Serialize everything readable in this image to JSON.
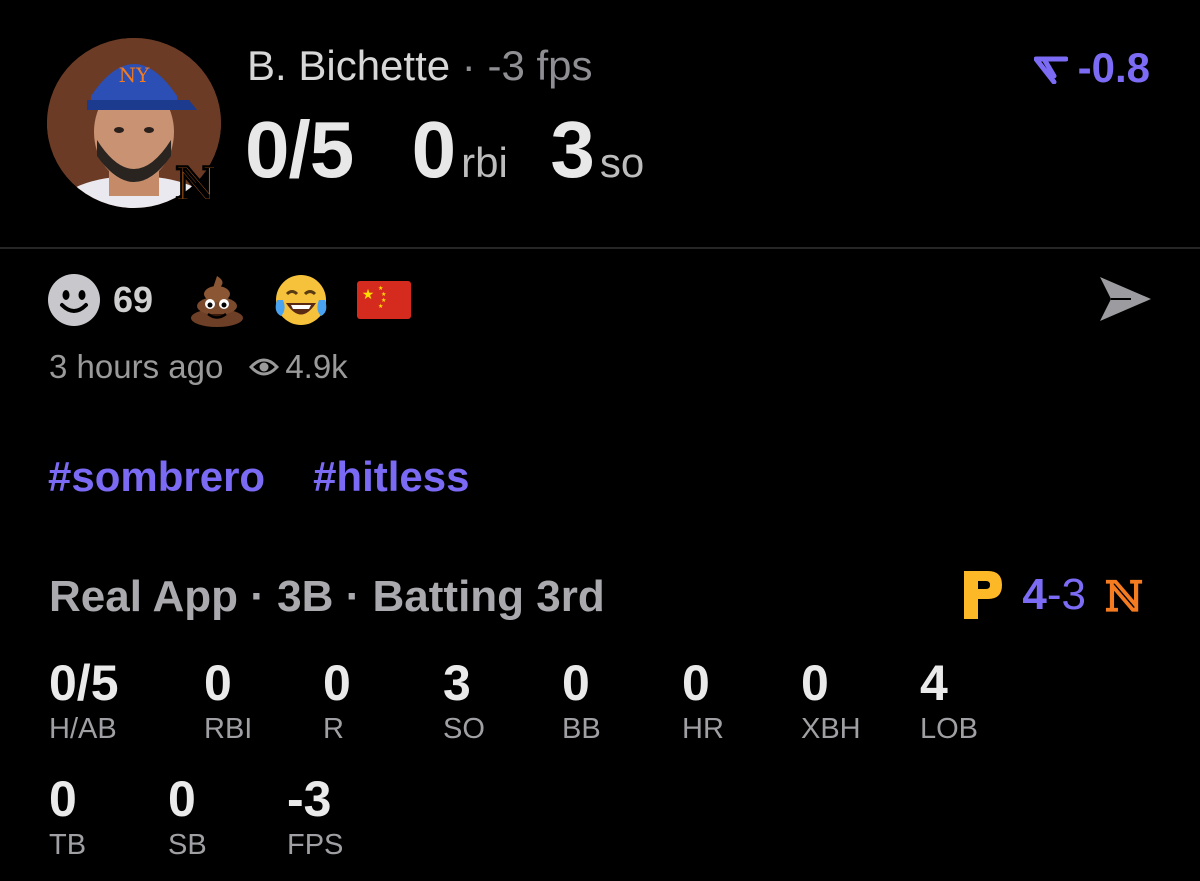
{
  "header": {
    "player_name": "B. Bichette",
    "separator": "·",
    "fps_text": "-3 fps",
    "hits_ab": "0/5",
    "rbi_value": "0",
    "rbi_unit": "rbi",
    "so_value": "3",
    "so_unit": "so",
    "delta_value": "-0.8",
    "accent_color": "#7c6cf5"
  },
  "reactions": {
    "smile_count": "69",
    "emojis": [
      "poop-emoji",
      "tears-of-joy-emoji",
      "china-flag-emoji"
    ]
  },
  "meta": {
    "time_ago": "3 hours ago",
    "views": "4.9k"
  },
  "tags": [
    "#sombrero",
    "#hitless"
  ],
  "game": {
    "info": "Real App · 3B · Batting 3rd",
    "score_a": "4",
    "score_dash": "-",
    "score_b": "3"
  },
  "stats_row1": [
    {
      "value": "0/5",
      "label": "H/AB"
    },
    {
      "value": "0",
      "label": "RBI"
    },
    {
      "value": "0",
      "label": "R"
    },
    {
      "value": "3",
      "label": "SO"
    },
    {
      "value": "0",
      "label": "BB"
    },
    {
      "value": "0",
      "label": "HR"
    },
    {
      "value": "0",
      "label": "XBH"
    },
    {
      "value": "4",
      "label": "LOB"
    }
  ],
  "stats_row2": [
    {
      "value": "0",
      "label": "TB"
    },
    {
      "value": "0",
      "label": "SB"
    },
    {
      "value": "-3",
      "label": "FPS"
    }
  ]
}
